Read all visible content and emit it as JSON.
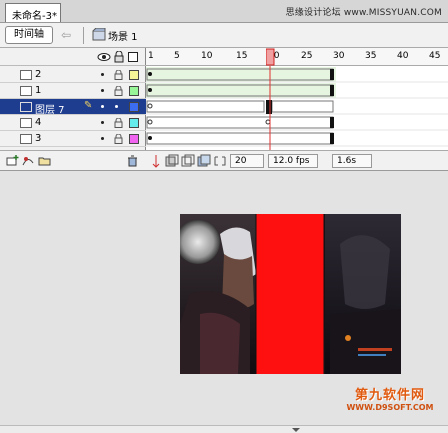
{
  "document_tab": {
    "title": "未命名-3*"
  },
  "watermark": {
    "text": "思缘设计论坛 www.MISSYUAN.COM"
  },
  "toolbar": {
    "timeline_label": "时间轴",
    "scene_label": "场景 1"
  },
  "layers": [
    {
      "name": "2",
      "color": "#f5f598",
      "selected": false
    },
    {
      "name": "1",
      "color": "#98f598",
      "selected": false
    },
    {
      "name": "图层 7",
      "color": "#3c6cf0",
      "selected": true
    },
    {
      "name": "4",
      "color": "#64ecec",
      "selected": false
    },
    {
      "name": "3",
      "color": "#f064f0",
      "selected": false
    }
  ],
  "ruler": {
    "ticks": [
      "1",
      "5",
      "10",
      "15",
      "20",
      "25",
      "30",
      "35",
      "40",
      "45"
    ],
    "current_frame": 20
  },
  "status": {
    "frame": "20",
    "fps": "12.0 fps",
    "time": "1.6s"
  },
  "logo": {
    "main": "第九软件网",
    "sub": "WWW.D9SOFT.COM"
  },
  "colors": {
    "selected_layer": "#1e3d8f",
    "playhead": "#e03030",
    "red_block": "#ff1010"
  }
}
